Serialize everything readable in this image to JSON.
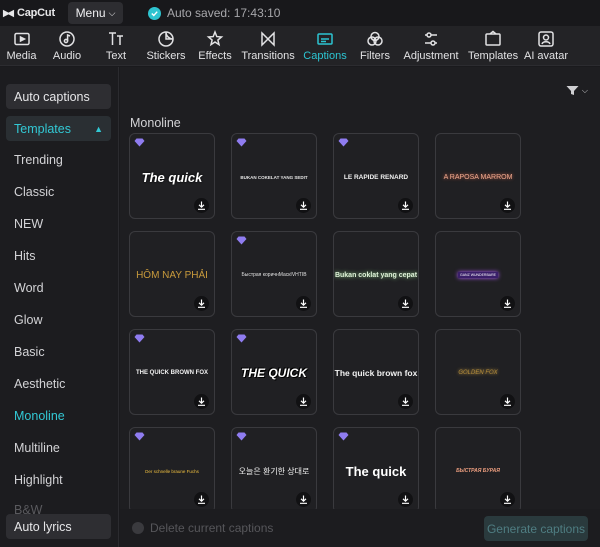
{
  "app": {
    "name": "CapCut"
  },
  "titlebar": {
    "menu_label": "Menu",
    "autosave_text": "Auto saved: 17:43:10"
  },
  "toolbar": {
    "items": [
      {
        "label": "Media",
        "icon": "media-icon"
      },
      {
        "label": "Audio",
        "icon": "audio-icon"
      },
      {
        "label": "Text",
        "icon": "text-icon"
      },
      {
        "label": "Stickers",
        "icon": "stickers-icon"
      },
      {
        "label": "Effects",
        "icon": "effects-icon"
      },
      {
        "label": "Transitions",
        "icon": "transitions-icon"
      },
      {
        "label": "Captions",
        "icon": "captions-icon",
        "active": true
      },
      {
        "label": "Filters",
        "icon": "filters-icon"
      },
      {
        "label": "Adjustment",
        "icon": "adjustment-icon"
      },
      {
        "label": "Templates",
        "icon": "templates-icon"
      },
      {
        "label": "AI avatar",
        "icon": "ai-avatar-icon"
      }
    ]
  },
  "sidebar": {
    "auto_captions": "Auto captions",
    "templates": "Templates",
    "items": [
      "Trending",
      "Classic",
      "NEW",
      "Hits",
      "Word",
      "Glow",
      "Basic",
      "Aesthetic",
      "Monoline",
      "Multiline",
      "Highlight",
      "B&W"
    ],
    "active_item": "Monoline",
    "auto_lyrics": "Auto lyrics"
  },
  "content": {
    "section_title": "Monoline",
    "cards": [
      {
        "preview": "The quick",
        "premium": true
      },
      {
        "preview": "BUKAN COKELAT YANG SEDIT",
        "premium": true
      },
      {
        "preview": "LE RAPIDE RENARD",
        "premium": true
      },
      {
        "preview": "A RAPOSA MARROM",
        "premium": false
      },
      {
        "preview": "HÔM NAY PHẢI",
        "premium": false
      },
      {
        "preview": "Быстрая коричнМаскIVHTIB",
        "premium": true
      },
      {
        "preview": "Bukan coklat yang cepat",
        "premium": false
      },
      {
        "preview": "GANZ WUNDERBARE",
        "premium": false
      },
      {
        "preview": "THE QUICK BROWN FOX",
        "premium": true
      },
      {
        "preview": "THE QUICK",
        "premium": true
      },
      {
        "preview": "The quick brown fox",
        "premium": false
      },
      {
        "preview": "GOLDEN FOX",
        "premium": false
      },
      {
        "preview": "Der schnelle braune Fuchs",
        "premium": true
      },
      {
        "preview": "오늘은 환기한 상대로",
        "premium": true
      },
      {
        "preview": "The quick",
        "premium": true
      },
      {
        "preview": "БЫСТРАЯ БУРАЯ",
        "premium": false
      }
    ]
  },
  "bottombar": {
    "delete_label": "Delete current captions",
    "generate_label": "Generate captions"
  },
  "colors": {
    "accent": "#2cc5d2",
    "gem": "#8f7cf0",
    "background": "#1e1e21"
  }
}
